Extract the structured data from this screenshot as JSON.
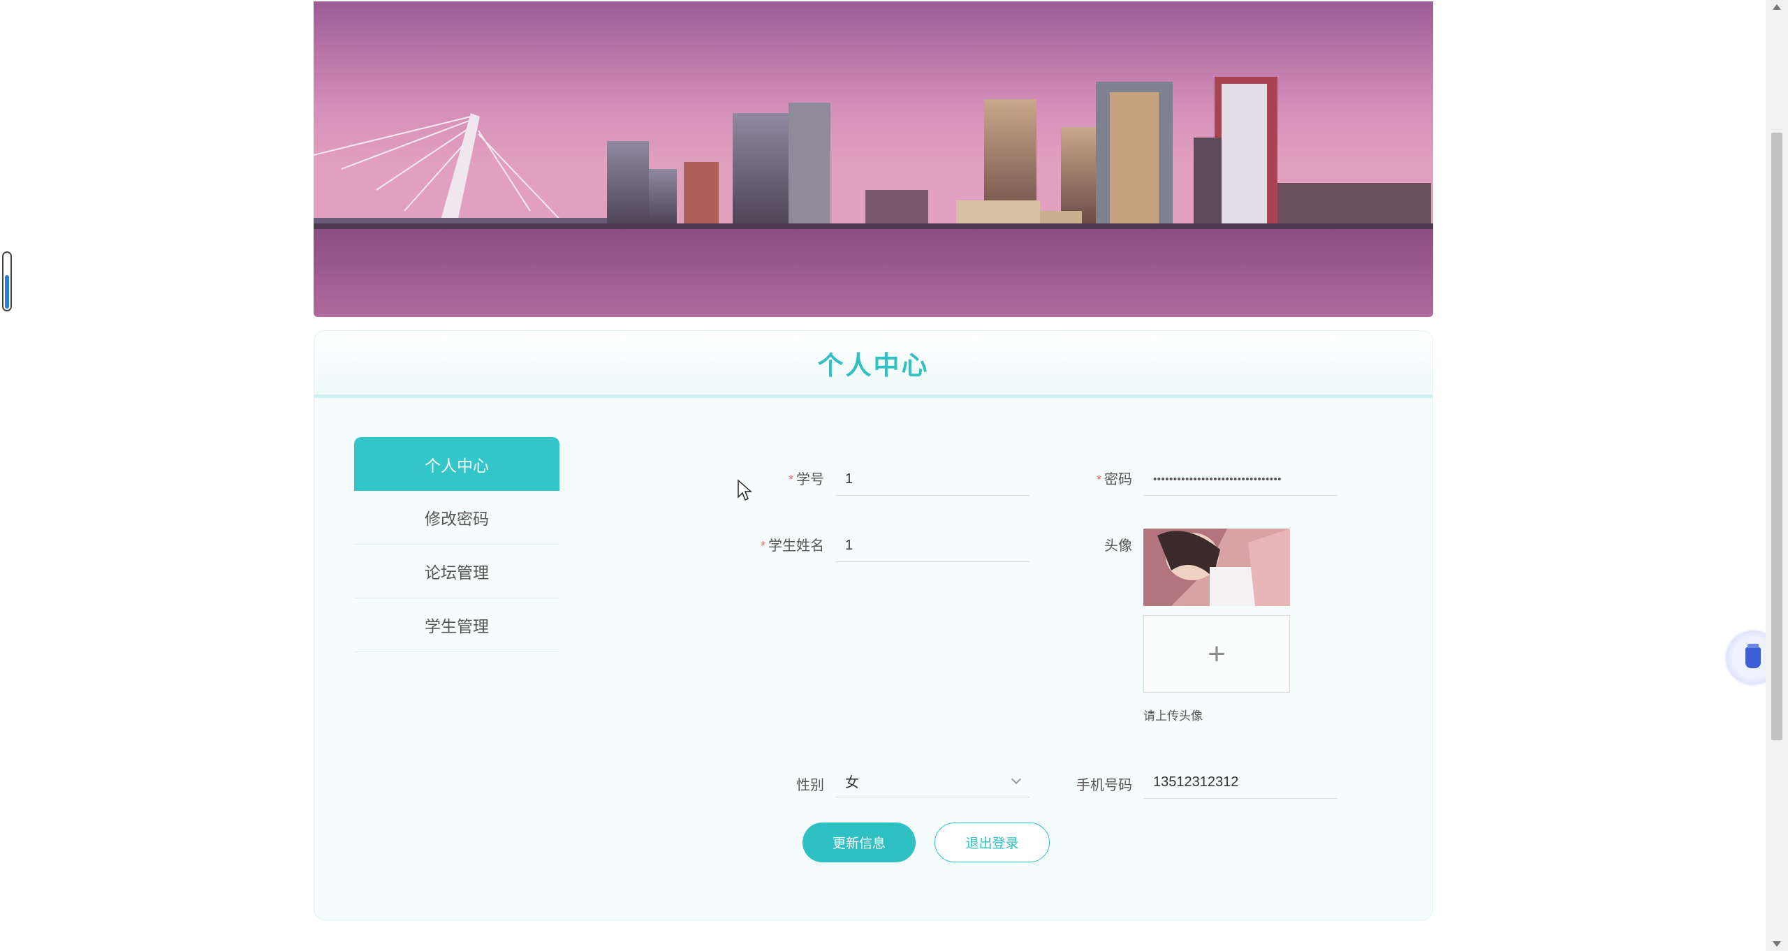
{
  "page": {
    "title": "个人中心"
  },
  "menu": {
    "items": [
      {
        "label": "个人中心",
        "active": true
      },
      {
        "label": "修改密码",
        "active": false
      },
      {
        "label": "论坛管理",
        "active": false
      },
      {
        "label": "学生管理",
        "active": false
      }
    ]
  },
  "form": {
    "student_id": {
      "label": "学号",
      "required": true,
      "value": "1"
    },
    "password": {
      "label": "密码",
      "required": true,
      "value": "••••••••••••••••••••••••••••••••"
    },
    "student_name": {
      "label": "学生姓名",
      "required": true,
      "value": "1"
    },
    "avatar": {
      "label": "头像",
      "upload_hint": "请上传头像"
    },
    "gender": {
      "label": "性别",
      "value": "女"
    },
    "phone": {
      "label": "手机号码",
      "value": "13512312312"
    }
  },
  "buttons": {
    "update": "更新信息",
    "logout": "退出登录"
  },
  "colors": {
    "accent": "#33c6c8",
    "required": "#f56c6c",
    "card_bg": "#f5fcfc"
  },
  "icons": {
    "upload": "plus-icon",
    "select": "chevron-down-icon",
    "float": "cup-icon"
  }
}
